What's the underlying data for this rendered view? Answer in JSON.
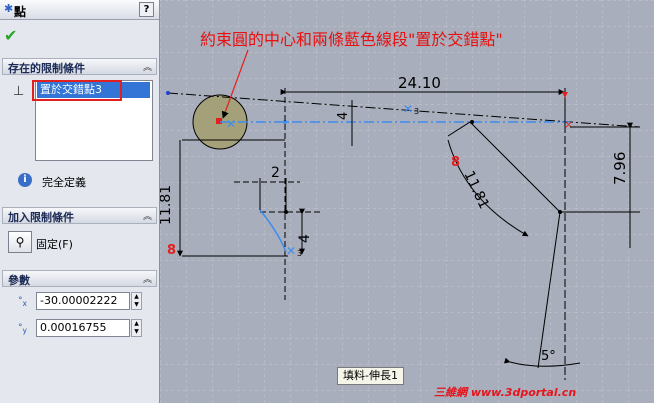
{
  "property_manager": {
    "title": "點",
    "help_symbol": "?",
    "ok_symbol": "✔",
    "existing_relations": {
      "header": "存在的限制條件",
      "item": "置於交錯點3",
      "status": "完全定義"
    },
    "add_relations": {
      "header": "加入限制條件",
      "fix_label": "固定(F)"
    },
    "parameters": {
      "header": "參數",
      "x_value": "-30.00002222",
      "y_value": "0.00016755",
      "x_sub": "x",
      "y_sub": "y"
    }
  },
  "drawing": {
    "annotation": "約束圓的中心和兩條藍色線段\"置於交錯點\"",
    "dimensions": {
      "d_2410": "24.10",
      "d_4_top": "4",
      "d_796": "7.96",
      "d_1181_left": "11.81",
      "d_2": "2",
      "d_4_mid": "4",
      "d_1181_arc": "11.81",
      "d_5deg": "5°"
    },
    "tooltip": "填料-伸長1",
    "watermark": "三維網 www.3dportal.cn"
  },
  "colors": {
    "canvas_bg": "#a8aebb",
    "blue_line": "#3d8cf0",
    "red": "#e81010"
  }
}
